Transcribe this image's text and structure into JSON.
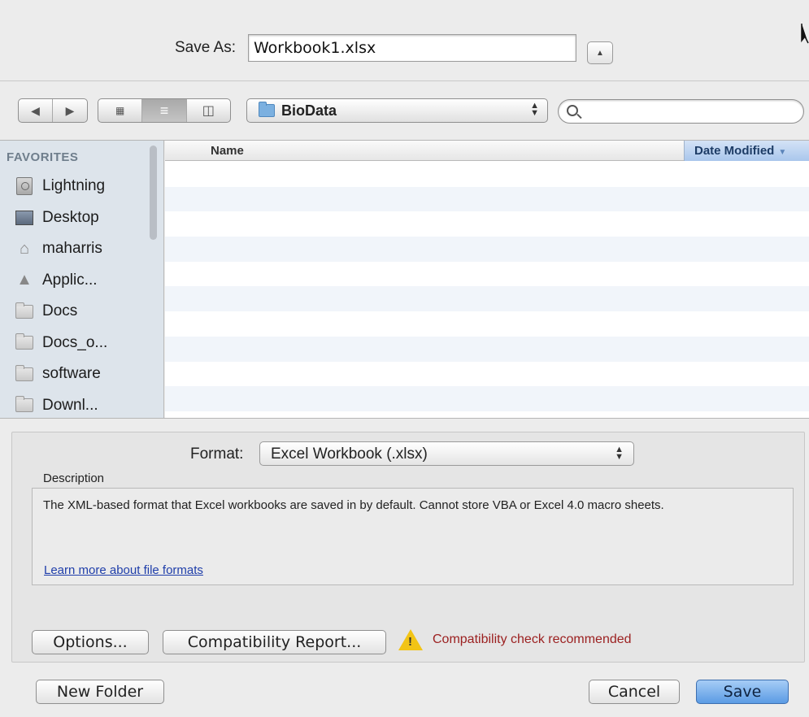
{
  "header": {
    "save_as_label": "Save As:",
    "filename": "Workbook1.xlsx"
  },
  "toolbar": {
    "back_icon": "back-arrow-icon",
    "forward_icon": "forward-arrow-icon",
    "views": [
      "icon-view",
      "list-view",
      "column-view"
    ],
    "active_view": "list-view",
    "location": "BioData",
    "search_value": ""
  },
  "sidebar": {
    "heading": "FAVORITES",
    "items": [
      {
        "label": "Lightning",
        "icon": "disk-icon"
      },
      {
        "label": "Desktop",
        "icon": "desktop-icon"
      },
      {
        "label": "maharris",
        "icon": "home-icon"
      },
      {
        "label": "Applic...",
        "icon": "applications-icon"
      },
      {
        "label": "Docs",
        "icon": "folder-icon"
      },
      {
        "label": "Docs_o...",
        "icon": "folder-icon"
      },
      {
        "label": "software",
        "icon": "folder-icon"
      },
      {
        "label": "Downl...",
        "icon": "folder-icon"
      }
    ]
  },
  "filelist": {
    "columns": {
      "name": "Name",
      "date": "Date Modified"
    },
    "sorted_by": "Date Modified"
  },
  "format": {
    "label": "Format:",
    "value": "Excel Workbook (.xlsx)",
    "description_label": "Description",
    "description": "The XML-based format that Excel workbooks are saved in by default. Cannot store VBA or Excel 4.0 macro sheets.",
    "learn_more": "Learn more about file formats"
  },
  "buttons": {
    "options": "Options...",
    "compatibility_report": "Compatibility Report...",
    "new_folder": "New Folder",
    "cancel": "Cancel",
    "save": "Save"
  },
  "warning": {
    "text": "Compatibility check recommended",
    "icon": "warning-icon",
    "color": "#9b1f1f"
  },
  "colors": {
    "accent": "#5b9be4",
    "selected_column": "#a9c6ec",
    "sidebar": "#dde4eb"
  }
}
